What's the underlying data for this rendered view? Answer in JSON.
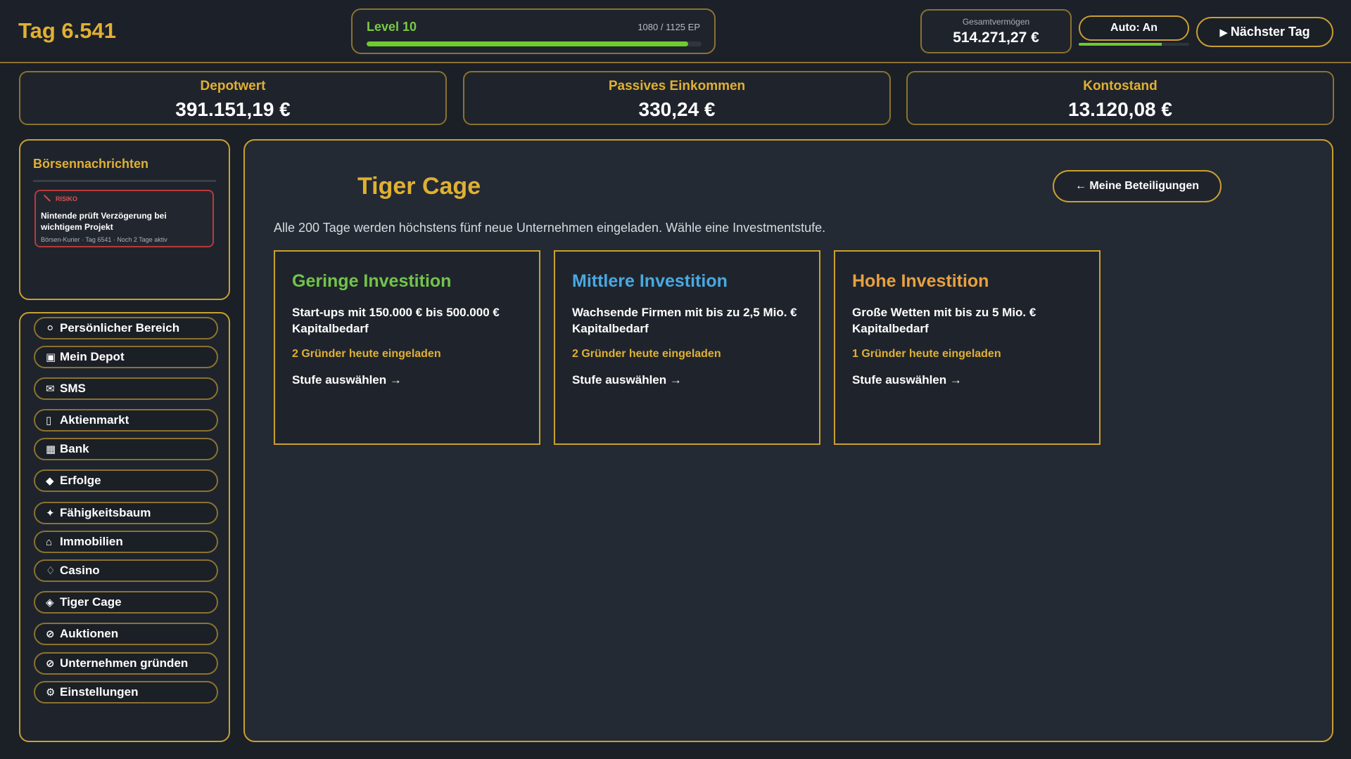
{
  "header": {
    "day_label": "Tag 6.541",
    "level_label": "Level 10",
    "ep_text": "1080 / 1125 EP",
    "level_progress": 0.96,
    "networth_label": "Gesamtvermögen",
    "networth_value": "514.271,27 €",
    "auto_label": "Auto: An",
    "auto_progress": 0.75,
    "next_day_label": "Nächster Tag"
  },
  "stats": {
    "depot": {
      "label": "Depotwert",
      "value": "391.151,19 €"
    },
    "passive": {
      "label": "Passives Einkommen",
      "value": "330,24 €"
    },
    "balance": {
      "label": "Kontostand",
      "value": "13.120,08 €"
    }
  },
  "news": {
    "title": "Börsennachrichten",
    "items": [
      {
        "tag": "RISIKO",
        "headline": "Nintende prüft Verzögerung bei wichtigem Projekt",
        "meta": "Börsen-Kurier · Tag 6541 · Noch 2 Tage aktiv"
      }
    ]
  },
  "nav": {
    "items": [
      {
        "icon": "⚪",
        "label": "Persönlicher Bereich"
      },
      {
        "icon": "▣",
        "label": "Mein Depot"
      },
      {
        "icon": "✉",
        "label": "SMS"
      },
      {
        "icon": "▯",
        "label": "Aktienmarkt"
      },
      {
        "icon": "▦",
        "label": "Bank"
      },
      {
        "icon": "◆",
        "label": "Erfolge"
      },
      {
        "icon": "✦",
        "label": "Fähigkeitsbaum"
      },
      {
        "icon": "⌂",
        "label": "Immobilien"
      },
      {
        "icon": "♢",
        "label": "Casino"
      },
      {
        "icon": "◈",
        "label": "Tiger Cage"
      },
      {
        "icon": "⊘",
        "label": "Auktionen"
      },
      {
        "icon": "⊘",
        "label": "Unternehmen gründen"
      },
      {
        "icon": "⚙",
        "label": "Einstellungen"
      }
    ]
  },
  "main": {
    "title": "Tiger Cage",
    "back_label": "← Meine Beteiligungen",
    "intro": "Alle 200 Tage werden höchstens fünf neue Unternehmen eingeladen. Wähle eine Investmentstufe.",
    "tiers": [
      {
        "title": "Geringe Investition",
        "color": "#72c44a",
        "desc": "Start-ups mit 150.000 € bis 500.000 € Kapitalbedarf",
        "count": "2 Gründer heute eingeladen",
        "select": "Stufe auswählen →"
      },
      {
        "title": "Mittlere Investition",
        "color": "#4aa8e0",
        "desc": "Wachsende Firmen mit bis zu 2,5 Mio. € Kapitalbedarf",
        "count": "2 Gründer heute eingeladen",
        "select": "Stufe auswählen →"
      },
      {
        "title": "Hohe Investition",
        "color": "#e8a040",
        "desc": "Große Wetten mit bis zu 5 Mio. € Kapitalbedarf",
        "count": "1 Gründer heute eingeladen",
        "select": "Stufe auswählen →"
      }
    ]
  },
  "colors": {
    "accent_gold": "#e0b033",
    "border_gold": "#c9a030",
    "progress_green": "#6fcc2e",
    "risk_red": "#d94848"
  }
}
